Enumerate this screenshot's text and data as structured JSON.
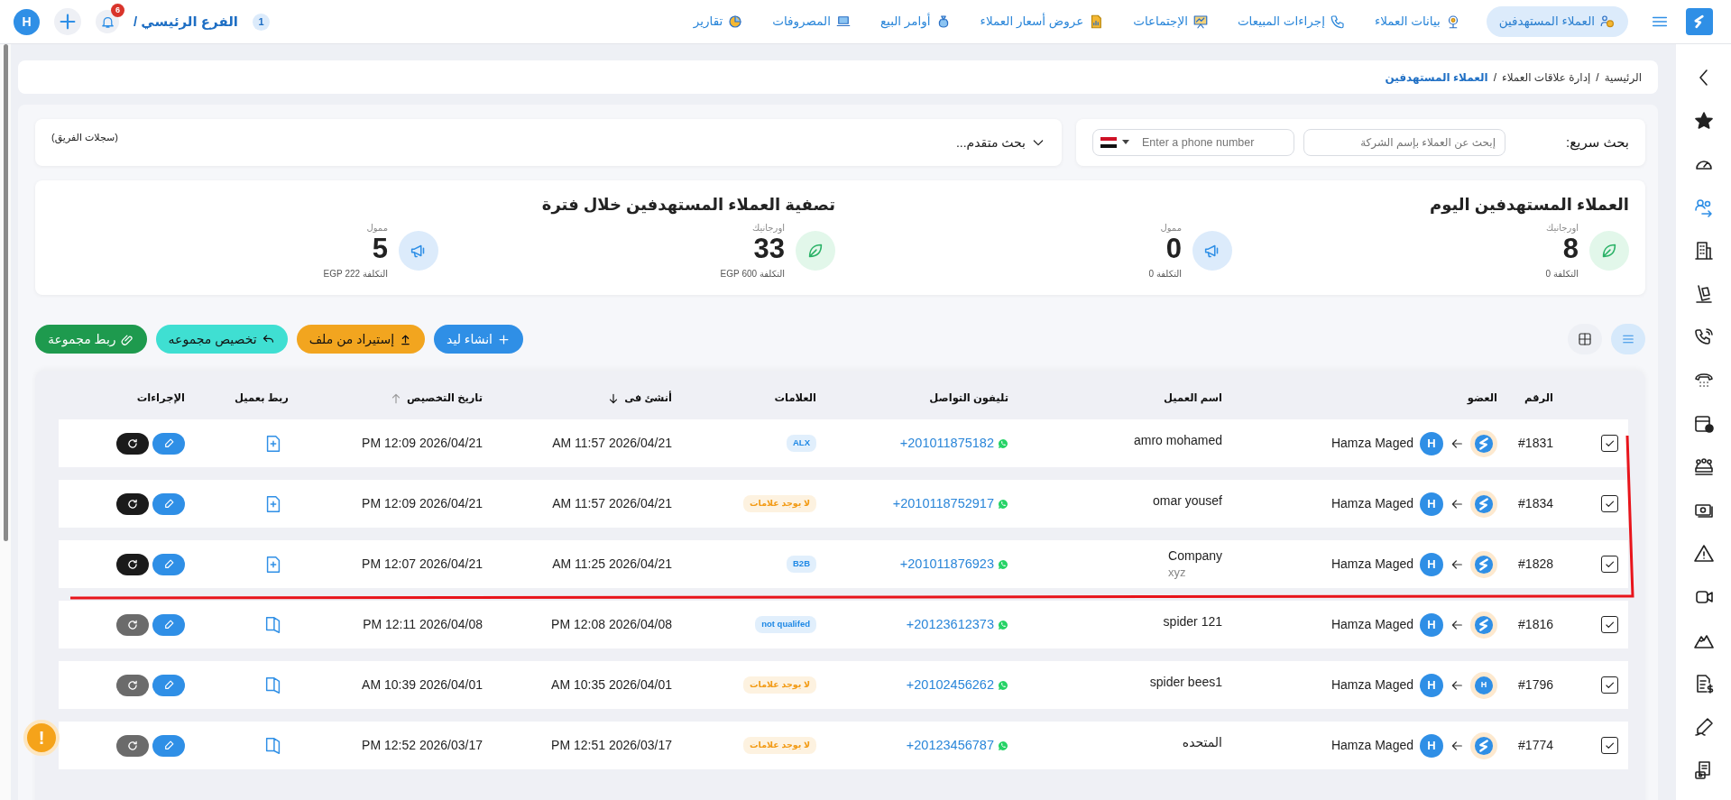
{
  "navbar": {
    "items": [
      {
        "label": "العملاء المستهدفين",
        "selected": true
      },
      {
        "label": "بيانات العملاء",
        "selected": false
      },
      {
        "label": "إجراءات المبيعات",
        "selected": false
      },
      {
        "label": "الإجتماعات",
        "selected": false
      },
      {
        "label": "عروض أسعار العملاء",
        "selected": false
      },
      {
        "label": "أوامر البيع",
        "selected": false
      },
      {
        "label": "المصروفات",
        "selected": false
      },
      {
        "label": "تقارير",
        "selected": false
      }
    ],
    "branch": {
      "label": "الفرع الرئيسي /",
      "count": "1"
    },
    "notifications": "6",
    "user_initial": "H"
  },
  "sidebar": {
    "items": [
      {
        "selected": false
      },
      {
        "selected": false
      },
      {
        "selected": false
      },
      {
        "selected": true
      },
      {
        "selected": false
      },
      {
        "selected": false
      },
      {
        "selected": false
      },
      {
        "selected": false
      },
      {
        "selected": false
      },
      {
        "selected": false
      },
      {
        "selected": false
      },
      {
        "selected": false
      },
      {
        "selected": false
      },
      {
        "selected": false
      },
      {
        "selected": false
      },
      {
        "selected": false
      },
      {
        "selected": false
      }
    ]
  },
  "breadcrumb": [
    {
      "kind": "link",
      "text": "الرئيسية"
    },
    {
      "kind": "separator",
      "text": "/"
    },
    {
      "kind": "link",
      "text": "إدارة علاقات العملاء"
    },
    {
      "kind": "separator",
      "text": "/"
    },
    {
      "kind": "current",
      "text": "العملاء المستهدفين"
    }
  ],
  "quick_search": {
    "label": "بحث سريع:",
    "company": {
      "placeholder": "إبحث عن العملاء بإسم الشركة"
    },
    "phone": {
      "placeholder": "Enter a phone number"
    }
  },
  "advanced_search": {
    "label": "بحث متقدم...",
    "team_records": "(سجلات الفريق)"
  },
  "stats": [
    {
      "title": "العملاء المستهدفين اليوم",
      "items": [
        {
          "kind": "organic",
          "label": "اورجانيك",
          "value": "8",
          "cost": "التكلفة 0"
        },
        {
          "kind": "paid",
          "label": "ممول",
          "value": "0",
          "cost": "التكلفة 0"
        }
      ]
    },
    {
      "title": "تصفية العملاء المستهدفين خلال فترة",
      "items": [
        {
          "kind": "organic",
          "label": "اورجانيك",
          "value": "33",
          "cost": "التكلفة 600 EGP"
        },
        {
          "kind": "paid",
          "label": "ممول",
          "value": "5",
          "cost": "التكلفة 222 EGP"
        }
      ]
    }
  ],
  "view_toggle": [
    {
      "kind": "list",
      "selected": true
    },
    {
      "kind": "grid",
      "selected": false
    }
  ],
  "actions": [
    {
      "kind": "create",
      "label": "انشاء ليد"
    },
    {
      "kind": "import",
      "label": "إستيراد من ملف"
    },
    {
      "kind": "assign",
      "label": "تخصيص مجموعه"
    },
    {
      "kind": "link",
      "label": "ربط مجموعة"
    }
  ],
  "table": {
    "columns": [
      {
        "label": "الرقم"
      },
      {
        "label": "العضو"
      },
      {
        "label": "اسم العميل"
      },
      {
        "label": "تليفون التواصل"
      },
      {
        "label": "العلامات"
      },
      {
        "label": "أنشئ فى",
        "sort_desc": true,
        "sort_active": true
      },
      {
        "label": "تاريخ التخصيص",
        "sort_desc": false,
        "sort_active": false
      },
      {
        "label": "ربط بعميل"
      },
      {
        "label": "الإجراءات"
      }
    ],
    "rows": [
      {
        "checked": true,
        "number": "#1831",
        "member": {
          "avatar": {
            "kind": "logo"
          },
          "initial": "H",
          "name": "Hamza Maged"
        },
        "name": "amro mohamed",
        "phone": "+201011875182",
        "tag": {
          "text": "ALX",
          "color": "#1e88e5"
        },
        "created": "AM 11:57 2026/04/21",
        "assigned": "PM 12:09 2026/04/21",
        "linked": false
      },
      {
        "checked": true,
        "number": "#1834",
        "member": {
          "avatar": {
            "kind": "logo"
          },
          "initial": "H",
          "name": "Hamza Maged"
        },
        "name": "omar yousef",
        "phone": "+2010118752917",
        "tag": {
          "text": "لا يوجد علامات",
          "color": "#f29b16"
        },
        "created": "AM 11:57 2026/04/21",
        "assigned": "PM 12:09 2026/04/21",
        "linked": false
      },
      {
        "checked": true,
        "number": "#1828",
        "member": {
          "avatar": {
            "kind": "logo"
          },
          "initial": "H",
          "name": "Hamza Maged"
        },
        "name": "Company",
        "name_note": "xyz",
        "phone": "+201011876923",
        "tag": {
          "text": "B2B",
          "color": "#1e88e5"
        },
        "created": "AM 11:25 2026/04/21",
        "assigned": "PM 12:07 2026/04/21",
        "linked": false
      },
      {
        "checked": true,
        "number": "#1816",
        "member": {
          "avatar": {
            "kind": "logo"
          },
          "initial": "H",
          "name": "Hamza Maged"
        },
        "name": "spider 121",
        "phone": "+20123612373",
        "tag": {
          "text": "not qualifed",
          "color": "#1e88e5"
        },
        "created": "PM 12:08 2026/04/08",
        "assigned": "PM 12:11 2026/04/08",
        "linked": true
      },
      {
        "checked": true,
        "number": "#1796",
        "member": {
          "avatar": {
            "kind": "letter",
            "letter": "H"
          },
          "initial": "H",
          "name": "Hamza Maged"
        },
        "name": "spider bees1",
        "phone": "+20102456262",
        "tag": {
          "text": "لا يوجد علامات",
          "color": "#f29b16"
        },
        "created": "AM 10:35 2026/04/01",
        "assigned": "AM 10:39 2026/04/01",
        "linked": true
      },
      {
        "checked": true,
        "number": "#1774",
        "member": {
          "avatar": {
            "kind": "logo"
          },
          "initial": "H",
          "name": "Hamza Maged"
        },
        "name": "المتحده",
        "phone": "+20123456787",
        "tag": {
          "text": "لا يوجد علامات",
          "color": "#f29b16"
        },
        "created": "PM 12:51 2026/03/17",
        "assigned": "PM 12:52 2026/03/17",
        "linked": true
      }
    ]
  },
  "help_button": "!"
}
